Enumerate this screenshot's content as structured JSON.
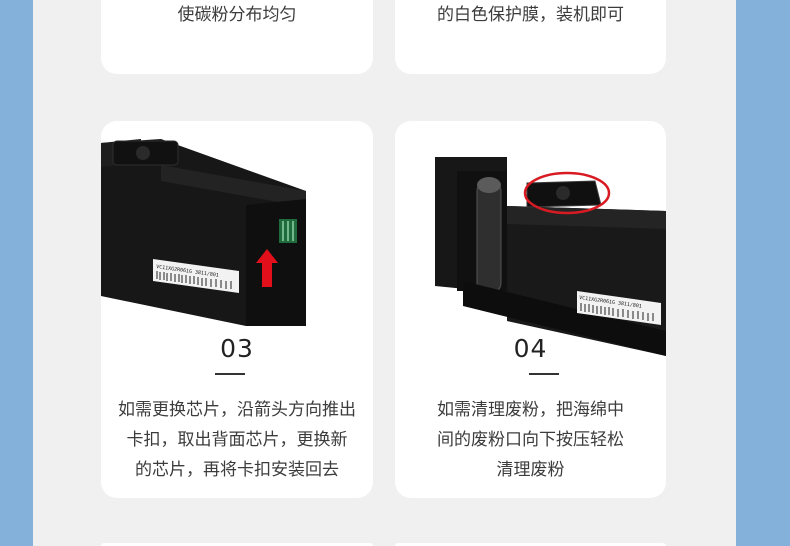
{
  "cards": [
    {
      "desc": "使碳粉分布均匀"
    },
    {
      "desc": "的白色保护膜，装机即可"
    },
    {
      "step": "03",
      "desc": [
        "如需更换芯片，沿箭头方向推出",
        "卡扣，取出背面芯片，更换新",
        "的芯片，再将卡扣安装回去"
      ],
      "label": "VC11XG2R061G  3811/801"
    },
    {
      "step": "04",
      "desc": [
        "如需清理废粉，把海绵中",
        "间的废粉口向下按压轻松",
        "清理废粉"
      ],
      "label": "VC11XG2R061G  3811/801"
    }
  ],
  "colors": {
    "background": "#84b1da",
    "panel": "#f0f0f0",
    "card": "#ffffff",
    "arrow": "#e3101c",
    "circle": "#d81a22"
  }
}
